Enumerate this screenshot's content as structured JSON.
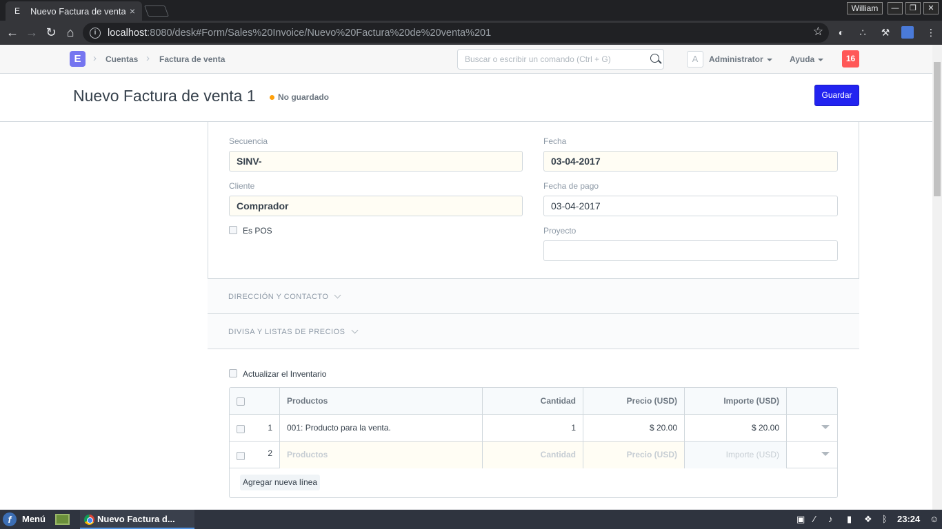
{
  "browser": {
    "tab_title": "Nuevo Factura de venta",
    "tab_favicon": "E",
    "tab_close": "×",
    "window_user": "William",
    "url_host": "localhost",
    "url_path": ":8080/desk#Form/Sales%20Invoice/Nuevo%20Factura%20de%20venta%201"
  },
  "navbar": {
    "logo": "E",
    "breadcrumbs": [
      "Cuentas",
      "Factura de venta"
    ],
    "search_placeholder": "Buscar o escribir un comando (Ctrl + G)",
    "avatar_letter": "A",
    "user": "Administrator",
    "help": "Ayuda",
    "notifications": "16"
  },
  "page": {
    "title": "Nuevo Factura de venta 1",
    "status": "No guardado",
    "save_label": "Guardar"
  },
  "form": {
    "secuencia_label": "Secuencia",
    "secuencia_value": "SINV-",
    "fecha_label": "Fecha",
    "fecha_value": "03-04-2017",
    "cliente_label": "Cliente",
    "cliente_value": "Comprador",
    "fecha_pago_label": "Fecha de pago",
    "fecha_pago_value": "03-04-2017",
    "es_pos_label": "Es POS",
    "proyecto_label": "Proyecto",
    "proyecto_value": "",
    "section_address": "DIRECCIÓN Y CONTACTO",
    "section_currency": "DIVISA Y LISTAS DE PRECIOS",
    "update_stock_label": "Actualizar el Inventario"
  },
  "grid": {
    "headers": [
      "Productos",
      "Cantidad",
      "Precio (USD)",
      "Importe (USD)"
    ],
    "rows": [
      {
        "idx": "1",
        "item": "001: Producto para la venta.",
        "qty": "1",
        "rate": "$ 20.00",
        "amount": "$ 20.00"
      },
      {
        "idx": "2",
        "item": "Productos",
        "qty": "Cantidad",
        "rate": "Precio (USD)",
        "amount": "Importe (USD)"
      }
    ],
    "add_row": "Agregar nueva línea"
  },
  "taskbar": {
    "menu": "Menú",
    "task": "Nuevo Factura d...",
    "clock": "23:24"
  },
  "colors": {
    "primary_button": "#2223f0",
    "unsaved_dot": "#ffa00a",
    "notification_badge": "#ff5858",
    "logo": "#7575f0"
  }
}
